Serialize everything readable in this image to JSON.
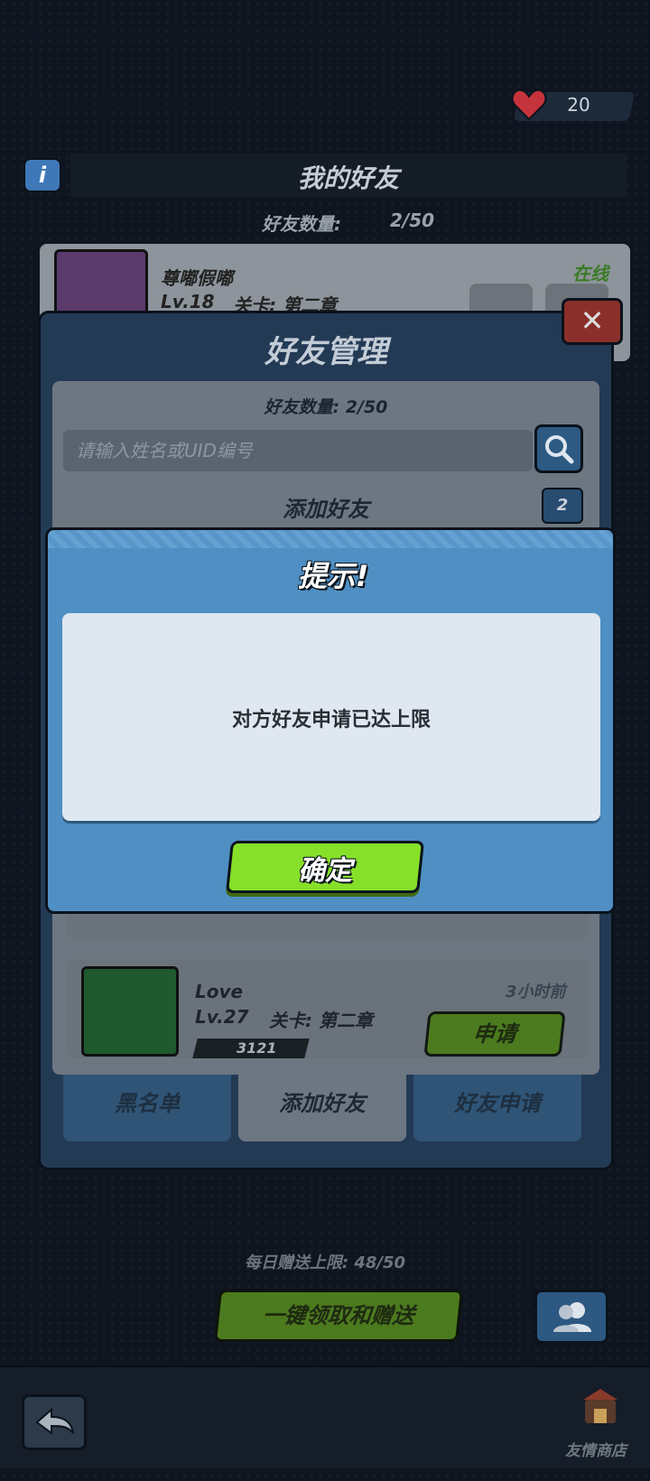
{
  "header": {
    "heart_count": "20",
    "title": "我的好友",
    "count_label": "好友数量:",
    "count_value": "2/50"
  },
  "friend": {
    "name": "尊嘟假嘟",
    "level": "Lv.18",
    "stage": "关卡: 第二章",
    "status": "在线"
  },
  "manage": {
    "title": "好友管理",
    "count_text": "好友数量: 2/50",
    "search_placeholder": "请输入姓名或UID编号",
    "add_friend_title": "添加好友",
    "refresh_count": "2"
  },
  "recommend": {
    "name": "Love",
    "level": "Lv.27",
    "stage": "关卡: 第二章",
    "power": "3121",
    "time": "3小时前",
    "apply_label": "申请"
  },
  "tabs": [
    {
      "label": "黑名单"
    },
    {
      "label": "添加好友"
    },
    {
      "label": "好友申请"
    }
  ],
  "footer": {
    "daily_limit": "每日赠送上限: 48/50",
    "one_key_label": "一键领取和赠送",
    "shop_label": "友情商店"
  },
  "dialog": {
    "title": "提示!",
    "message": "对方好友申请已达上限",
    "confirm_label": "确定"
  },
  "colors": {
    "dialog_bg": "#4f8fc3",
    "confirm_green": "#86e02a",
    "heart_red": "#e0303a"
  }
}
